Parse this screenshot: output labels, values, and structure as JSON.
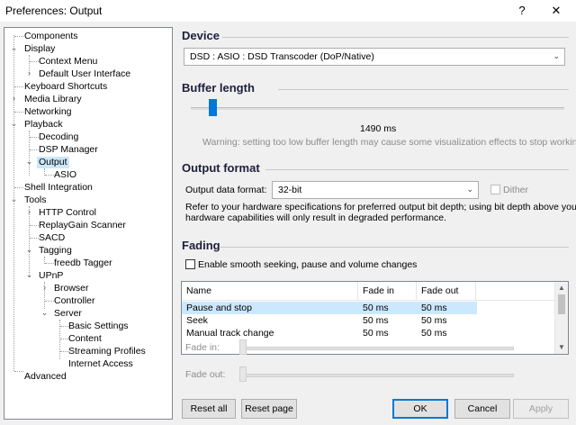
{
  "window": {
    "title": "Preferences: Output",
    "help_glyph": "?",
    "close_glyph": "✕"
  },
  "tree": {
    "items": [
      {
        "label": "Components"
      },
      {
        "label": "Display"
      },
      {
        "label": "Context Menu"
      },
      {
        "label": "Default User Interface"
      },
      {
        "label": "Keyboard Shortcuts"
      },
      {
        "label": "Media Library"
      },
      {
        "label": "Networking"
      },
      {
        "label": "Playback"
      },
      {
        "label": "Decoding"
      },
      {
        "label": "DSP Manager"
      },
      {
        "label": "Output"
      },
      {
        "label": "ASIO"
      },
      {
        "label": "Shell Integration"
      },
      {
        "label": "Tools"
      },
      {
        "label": "HTTP Control"
      },
      {
        "label": "ReplayGain Scanner"
      },
      {
        "label": "SACD"
      },
      {
        "label": "Tagging"
      },
      {
        "label": "freedb Tagger"
      },
      {
        "label": "UPnP"
      },
      {
        "label": "Browser"
      },
      {
        "label": "Controller"
      },
      {
        "label": "Server"
      },
      {
        "label": "Basic Settings"
      },
      {
        "label": "Content"
      },
      {
        "label": "Streaming Profiles"
      },
      {
        "label": "Internet Access"
      },
      {
        "label": "Advanced"
      }
    ],
    "selected": "Output"
  },
  "device": {
    "heading": "Device",
    "selected": "DSD : ASIO : DSD Transcoder (DoP/Native)"
  },
  "buffer": {
    "heading": "Buffer length",
    "value_label": "1490 ms",
    "slider_fraction": 0.07,
    "warning": "Warning: setting too low buffer length may cause some visualization effects to stop working."
  },
  "output_format": {
    "heading": "Output format",
    "label": "Output data format:",
    "selected": "32-bit",
    "dither_label": "Dither",
    "note_line1": "Refer to your hardware specifications for preferred output bit depth; using bit depth above your",
    "note_line2": "hardware capabilities will only result in degraded performance."
  },
  "fading": {
    "heading": "Fading",
    "checkbox_label": "Enable smooth seeking, pause and volume changes",
    "columns": [
      "Name",
      "Fade in",
      "Fade out"
    ],
    "rows": [
      {
        "name": "Pause and stop",
        "fade_in": "50 ms",
        "fade_out": "50 ms"
      },
      {
        "name": "Seek",
        "fade_in": "50 ms",
        "fade_out": "50 ms"
      },
      {
        "name": "Manual track change",
        "fade_in": "50 ms",
        "fade_out": "50 ms"
      }
    ],
    "fade_in_label": "Fade in:",
    "fade_out_label": "Fade out:"
  },
  "buttons": {
    "reset_all": "Reset all",
    "reset_page": "Reset page",
    "ok": "OK",
    "cancel": "Cancel",
    "apply": "Apply"
  },
  "icons": {
    "expanded": "chevron-down-icon",
    "collapsed": "chevron-right-icon",
    "dropdown": "chevron-down-icon"
  },
  "colors": {
    "selection": "#cce8ff",
    "heading": "#1e1e3c",
    "accent": "#0078d7"
  }
}
